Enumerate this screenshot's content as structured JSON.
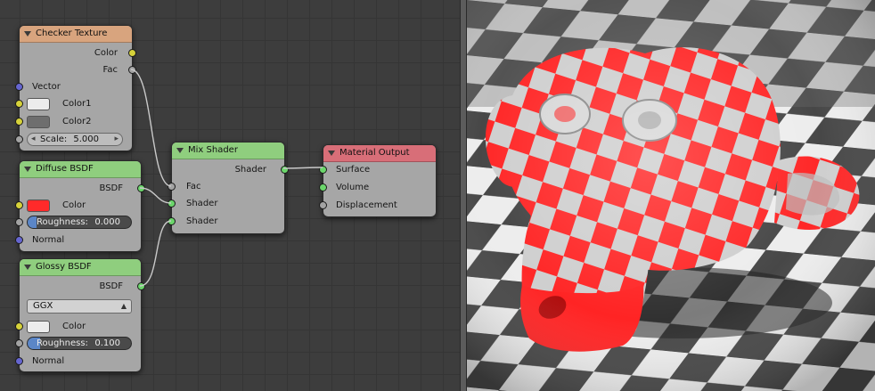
{
  "nodes": {
    "checker": {
      "title": "Checker Texture",
      "outputs": {
        "color": "Color",
        "fac": "Fac"
      },
      "inputs": {
        "vector": "Vector",
        "color1": "Color1",
        "color2": "Color2",
        "scale_label": "Scale:",
        "scale_value": "5.000"
      },
      "color1_hex": "#ececec",
      "color2_hex": "#6e6e6e"
    },
    "diffuse": {
      "title": "Diffuse BSDF",
      "output": "BSDF",
      "color_label": "Color",
      "color_hex": "#ff2a2a",
      "roughness_label": "Roughness:",
      "roughness_value": "0.000",
      "normal_label": "Normal"
    },
    "glossy": {
      "title": "Glossy BSDF",
      "output": "BSDF",
      "distribution": "GGX",
      "color_label": "Color",
      "color_hex": "#ececec",
      "roughness_label": "Roughness:",
      "roughness_value": "0.100",
      "normal_label": "Normal"
    },
    "mix": {
      "title": "Mix Shader",
      "output": "Shader",
      "inputs": {
        "fac": "Fac",
        "shader1": "Shader",
        "shader2": "Shader"
      }
    },
    "output": {
      "title": "Material Output",
      "inputs": {
        "surface": "Surface",
        "volume": "Volume",
        "displacement": "Displacement"
      }
    }
  },
  "colors": {
    "texture_header": "#d8a47e",
    "shader_header": "#8fce7e",
    "output_header": "#d86e78",
    "socket_color": "#d6d23a",
    "socket_shader": "#6bd66b",
    "socket_vector": "#6666d0",
    "socket_float": "#a3a3a3"
  },
  "render": {
    "subject": "suzanne monkey head",
    "materials": [
      "red diffuse",
      "chrome glossy"
    ],
    "floor": "checkerboard"
  }
}
